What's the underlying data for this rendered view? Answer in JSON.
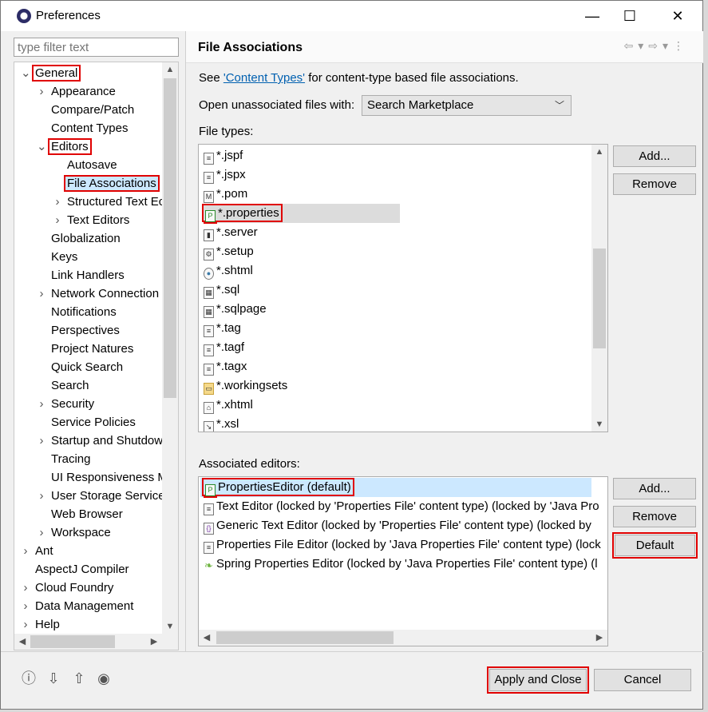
{
  "window": {
    "title": "Preferences",
    "minimize": "—",
    "maximize": "☐",
    "close": "✕"
  },
  "filter": {
    "placeholder": "type filter text"
  },
  "tree": [
    {
      "label": "General",
      "level": 0,
      "twisty": "open"
    },
    {
      "label": "Appearance",
      "level": 1,
      "twisty": "closed"
    },
    {
      "label": "Compare/Patch",
      "level": 1,
      "twisty": ""
    },
    {
      "label": "Content Types",
      "level": 1,
      "twisty": ""
    },
    {
      "label": "Editors",
      "level": 1,
      "twisty": "open"
    },
    {
      "label": "Autosave",
      "level": 2,
      "twisty": ""
    },
    {
      "label": "File Associations",
      "level": 2,
      "twisty": "",
      "selected": true
    },
    {
      "label": "Structured Text Ec",
      "level": 2,
      "twisty": "closed"
    },
    {
      "label": "Text Editors",
      "level": 2,
      "twisty": "closed"
    },
    {
      "label": "Globalization",
      "level": 1,
      "twisty": ""
    },
    {
      "label": "Keys",
      "level": 1,
      "twisty": ""
    },
    {
      "label": "Link Handlers",
      "level": 1,
      "twisty": ""
    },
    {
      "label": "Network Connection",
      "level": 1,
      "twisty": "closed"
    },
    {
      "label": "Notifications",
      "level": 1,
      "twisty": ""
    },
    {
      "label": "Perspectives",
      "level": 1,
      "twisty": ""
    },
    {
      "label": "Project Natures",
      "level": 1,
      "twisty": ""
    },
    {
      "label": "Quick Search",
      "level": 1,
      "twisty": ""
    },
    {
      "label": "Search",
      "level": 1,
      "twisty": ""
    },
    {
      "label": "Security",
      "level": 1,
      "twisty": "closed"
    },
    {
      "label": "Service Policies",
      "level": 1,
      "twisty": ""
    },
    {
      "label": "Startup and Shutdow",
      "level": 1,
      "twisty": "closed"
    },
    {
      "label": "Tracing",
      "level": 1,
      "twisty": ""
    },
    {
      "label": "UI Responsiveness M",
      "level": 1,
      "twisty": ""
    },
    {
      "label": "User Storage Service",
      "level": 1,
      "twisty": "closed"
    },
    {
      "label": "Web Browser",
      "level": 1,
      "twisty": ""
    },
    {
      "label": "Workspace",
      "level": 1,
      "twisty": "closed"
    },
    {
      "label": "Ant",
      "level": 0,
      "twisty": "closed"
    },
    {
      "label": "AspectJ Compiler",
      "level": 0,
      "twisty": ""
    },
    {
      "label": "Cloud Foundry",
      "level": 0,
      "twisty": "closed"
    },
    {
      "label": "Data Management",
      "level": 0,
      "twisty": "closed"
    },
    {
      "label": "Help",
      "level": 0,
      "twisty": "closed"
    }
  ],
  "page": {
    "title": "File Associations",
    "see_prefix": "See ",
    "see_link": "'Content Types'",
    "see_suffix": " for content-type based file associations.",
    "open_label": "Open unassociated files with:",
    "open_value": "Search Marketplace",
    "file_types_label": "File types:",
    "associated_label": "Associated editors:"
  },
  "file_types": [
    {
      "name": "*.jspf",
      "icon": "file-icon"
    },
    {
      "name": "*.jspx",
      "icon": "file-icon"
    },
    {
      "name": "*.pom",
      "icon": "maven-icon"
    },
    {
      "name": "*.properties",
      "icon": "properties-icon",
      "selected": true
    },
    {
      "name": "*.server",
      "icon": "server-icon"
    },
    {
      "name": "*.setup",
      "icon": "setup-icon"
    },
    {
      "name": "*.shtml",
      "icon": "globe-icon"
    },
    {
      "name": "*.sql",
      "icon": "sql-icon"
    },
    {
      "name": "*.sqlpage",
      "icon": "sql-icon"
    },
    {
      "name": "*.tag",
      "icon": "file-icon"
    },
    {
      "name": "*.tagf",
      "icon": "file-icon"
    },
    {
      "name": "*.tagx",
      "icon": "file-icon"
    },
    {
      "name": "*.workingsets",
      "icon": "folder-icon"
    },
    {
      "name": "*.xhtml",
      "icon": "xhtml-icon"
    },
    {
      "name": "*.xsl",
      "icon": "xsl-icon"
    }
  ],
  "associated_editors": [
    {
      "name": "PropertiesEditor (default)",
      "icon": "properties-icon",
      "selected": true
    },
    {
      "name": "Text Editor (locked by 'Properties File' content type) (locked by 'Java Pro",
      "icon": "file-icon"
    },
    {
      "name": "Generic Text Editor (locked by 'Properties File' content type) (locked by",
      "icon": "generic-editor-icon"
    },
    {
      "name": "Properties File Editor (locked by 'Java Properties File' content type) (lock",
      "icon": "file-icon"
    },
    {
      "name": "Spring Properties Editor (locked by 'Java Properties File' content type) (l",
      "icon": "spring-leaf-icon"
    }
  ],
  "buttons": {
    "add": "Add...",
    "remove": "Remove",
    "add2": "Add...",
    "remove2": "Remove",
    "default": "Default",
    "apply_close": "Apply and Close",
    "cancel": "Cancel"
  },
  "footer_icons": [
    "help-icon",
    "import-icon",
    "export-icon",
    "record-icon"
  ],
  "colors": {
    "selection": "#cce8ff",
    "highlight_box": "#e00000",
    "link": "#0060b0"
  }
}
